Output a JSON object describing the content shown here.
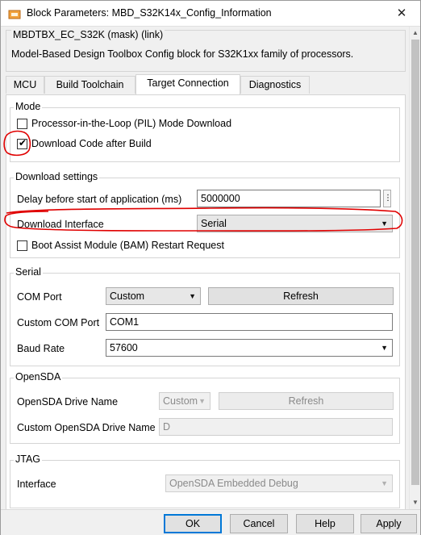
{
  "window": {
    "title": "Block Parameters: MBD_S32K14x_Config_Information",
    "close_glyph": "✕"
  },
  "mask": {
    "title": "MBDTBX_EC_S32K (mask) (link)",
    "description": "Model-Based Design Toolbox Config block for S32K1xx family of processors."
  },
  "tabs": [
    {
      "label": "MCU"
    },
    {
      "label": "Build Toolchain"
    },
    {
      "label": "Target Connection"
    },
    {
      "label": "Diagnostics"
    }
  ],
  "mode": {
    "title": "Mode",
    "pil_label": "Processor-in-the-Loop (PIL) Mode Download",
    "pil_checked": false,
    "download_label": "Download Code after Build",
    "download_checked": true
  },
  "download_settings": {
    "title": "Download settings",
    "delay_label": "Delay before start of application (ms)",
    "delay_value": "5000000",
    "dots": "⋮",
    "interface_label": "Download Interface",
    "interface_value": "Serial",
    "bam_label": "Boot Assist Module (BAM) Restart Request",
    "bam_checked": false
  },
  "serial": {
    "title": "Serial",
    "com_port_label": "COM Port",
    "com_port_value": "Custom",
    "refresh_label": "Refresh",
    "custom_com_label": "Custom COM Port",
    "custom_com_value": "COM1",
    "baud_label": "Baud Rate",
    "baud_value": "57600"
  },
  "opensda": {
    "title": "OpenSDA",
    "drive_label": "OpenSDA Drive Name",
    "drive_value": "Custom",
    "refresh_label": "Refresh",
    "custom_label": "Custom OpenSDA Drive Name",
    "custom_value": "D"
  },
  "jtag": {
    "title": "JTAG",
    "interface_label": "Interface",
    "interface_value": "OpenSDA Embedded Debug"
  },
  "buttons": {
    "ok": "OK",
    "cancel": "Cancel",
    "help": "Help",
    "apply": "Apply"
  },
  "icons": {
    "app": "simulink-block-icon",
    "dropdown": "chevron-down-icon",
    "scroll_up": "scroll-up-arrow-icon",
    "scroll_down": "scroll-down-arrow-icon"
  },
  "colors": {
    "annotation": "#e00000",
    "default_button": "#0078d7"
  }
}
